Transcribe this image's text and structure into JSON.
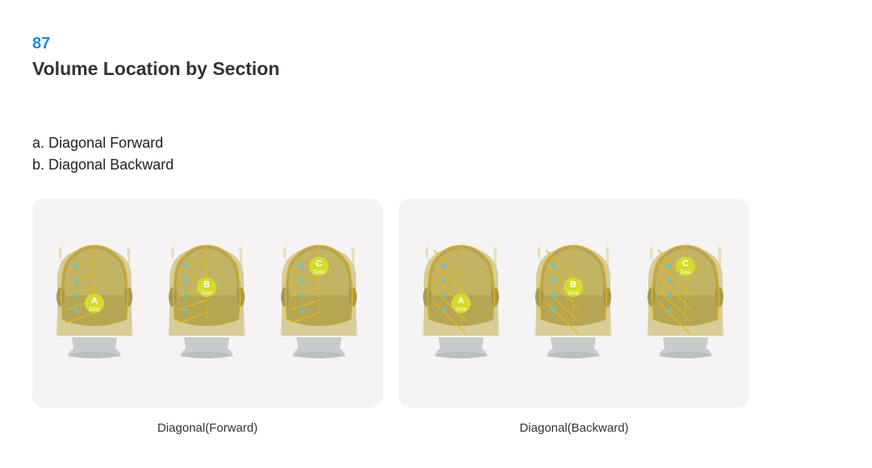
{
  "header": {
    "number": "87",
    "title": "Volume Location by Section"
  },
  "list": [
    "a. Diagonal Forward",
    "b. Diagonal Backward"
  ],
  "zone_word": "Zone",
  "panels": [
    {
      "caption": "Diagonal(Forward)",
      "heads": [
        {
          "zone_letter": "A",
          "direction": "forward"
        },
        {
          "zone_letter": "B",
          "direction": "forward"
        },
        {
          "zone_letter": "C",
          "direction": "forward"
        }
      ]
    },
    {
      "caption": "Diagonal(Backward)",
      "heads": [
        {
          "zone_letter": "A",
          "direction": "backward"
        },
        {
          "zone_letter": "B",
          "direction": "backward"
        },
        {
          "zone_letter": "C",
          "direction": "backward"
        }
      ]
    }
  ],
  "colors": {
    "accent": "#1e88e5",
    "panel_bg": "#f5f3f3",
    "hair": "#d8cc98",
    "section_line": "#e6b81e",
    "zone_circle": "#d4dc2a",
    "arrow": "#5bc8d8",
    "neck": "#c8cdcb"
  }
}
